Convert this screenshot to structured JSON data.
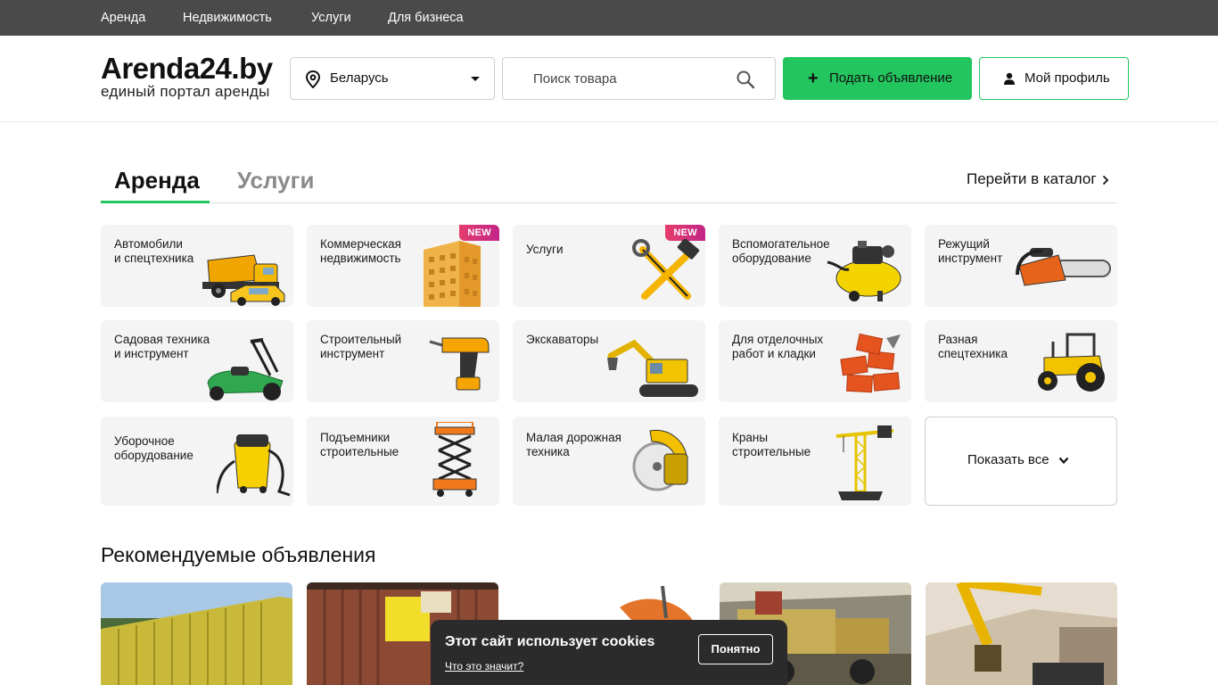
{
  "topnav": {
    "items": [
      {
        "label": "Аренда"
      },
      {
        "label": "Недвижимость"
      },
      {
        "label": "Услуги"
      },
      {
        "label": "Для бизнеса"
      }
    ]
  },
  "header": {
    "logo_title": "Arenda24.by",
    "logo_subtitle": "единый портал аренды",
    "region_value": "Беларусь",
    "search_placeholder": "Поиск товара",
    "post_button": "Подать объявление",
    "profile_button": "Мой профиль",
    "accent_color": "#22c55e"
  },
  "tabs": {
    "items": [
      {
        "label": "Аренда",
        "active": true
      },
      {
        "label": "Услуги",
        "active": false
      }
    ],
    "catalog_link": "Перейти в каталог"
  },
  "categories": [
    {
      "title": "Автомобили\nи спецтехника",
      "icon": "dump-truck-icon"
    },
    {
      "title": "Коммерческая\nнедвижимость",
      "icon": "building-icon",
      "badge": "NEW"
    },
    {
      "title": "Услуги",
      "icon": "hammer-wrench-icon",
      "badge": "NEW"
    },
    {
      "title": "Вспомогательное\nоборудование",
      "icon": "compressor-icon"
    },
    {
      "title": "Режущий\nинструмент",
      "icon": "chainsaw-icon"
    },
    {
      "title": "Садовая техника\nи инструмент",
      "icon": "lawn-mower-icon"
    },
    {
      "title": "Строительный\nинструмент",
      "icon": "drill-icon"
    },
    {
      "title": "Экскаваторы",
      "icon": "excavator-icon"
    },
    {
      "title": "Для отделочных\nработ и кладки",
      "icon": "bricks-icon"
    },
    {
      "title": "Разная\nспецтехника",
      "icon": "tractor-icon"
    },
    {
      "title": "Уборочное\nоборудование",
      "icon": "vacuum-cleaner-icon"
    },
    {
      "title": "Подъемники\nстроительные",
      "icon": "scissor-lift-icon"
    },
    {
      "title": "Малая дорожная\nтехника",
      "icon": "road-saw-icon"
    },
    {
      "title": "Краны\nстроительные",
      "icon": "tower-crane-icon"
    }
  ],
  "show_all": "Показать все",
  "recommended": {
    "title": "Рекомендуемые объявления"
  },
  "cookie": {
    "text": "Этот сайт использует cookies",
    "link": "Что это значит?",
    "button": "Понятно"
  }
}
